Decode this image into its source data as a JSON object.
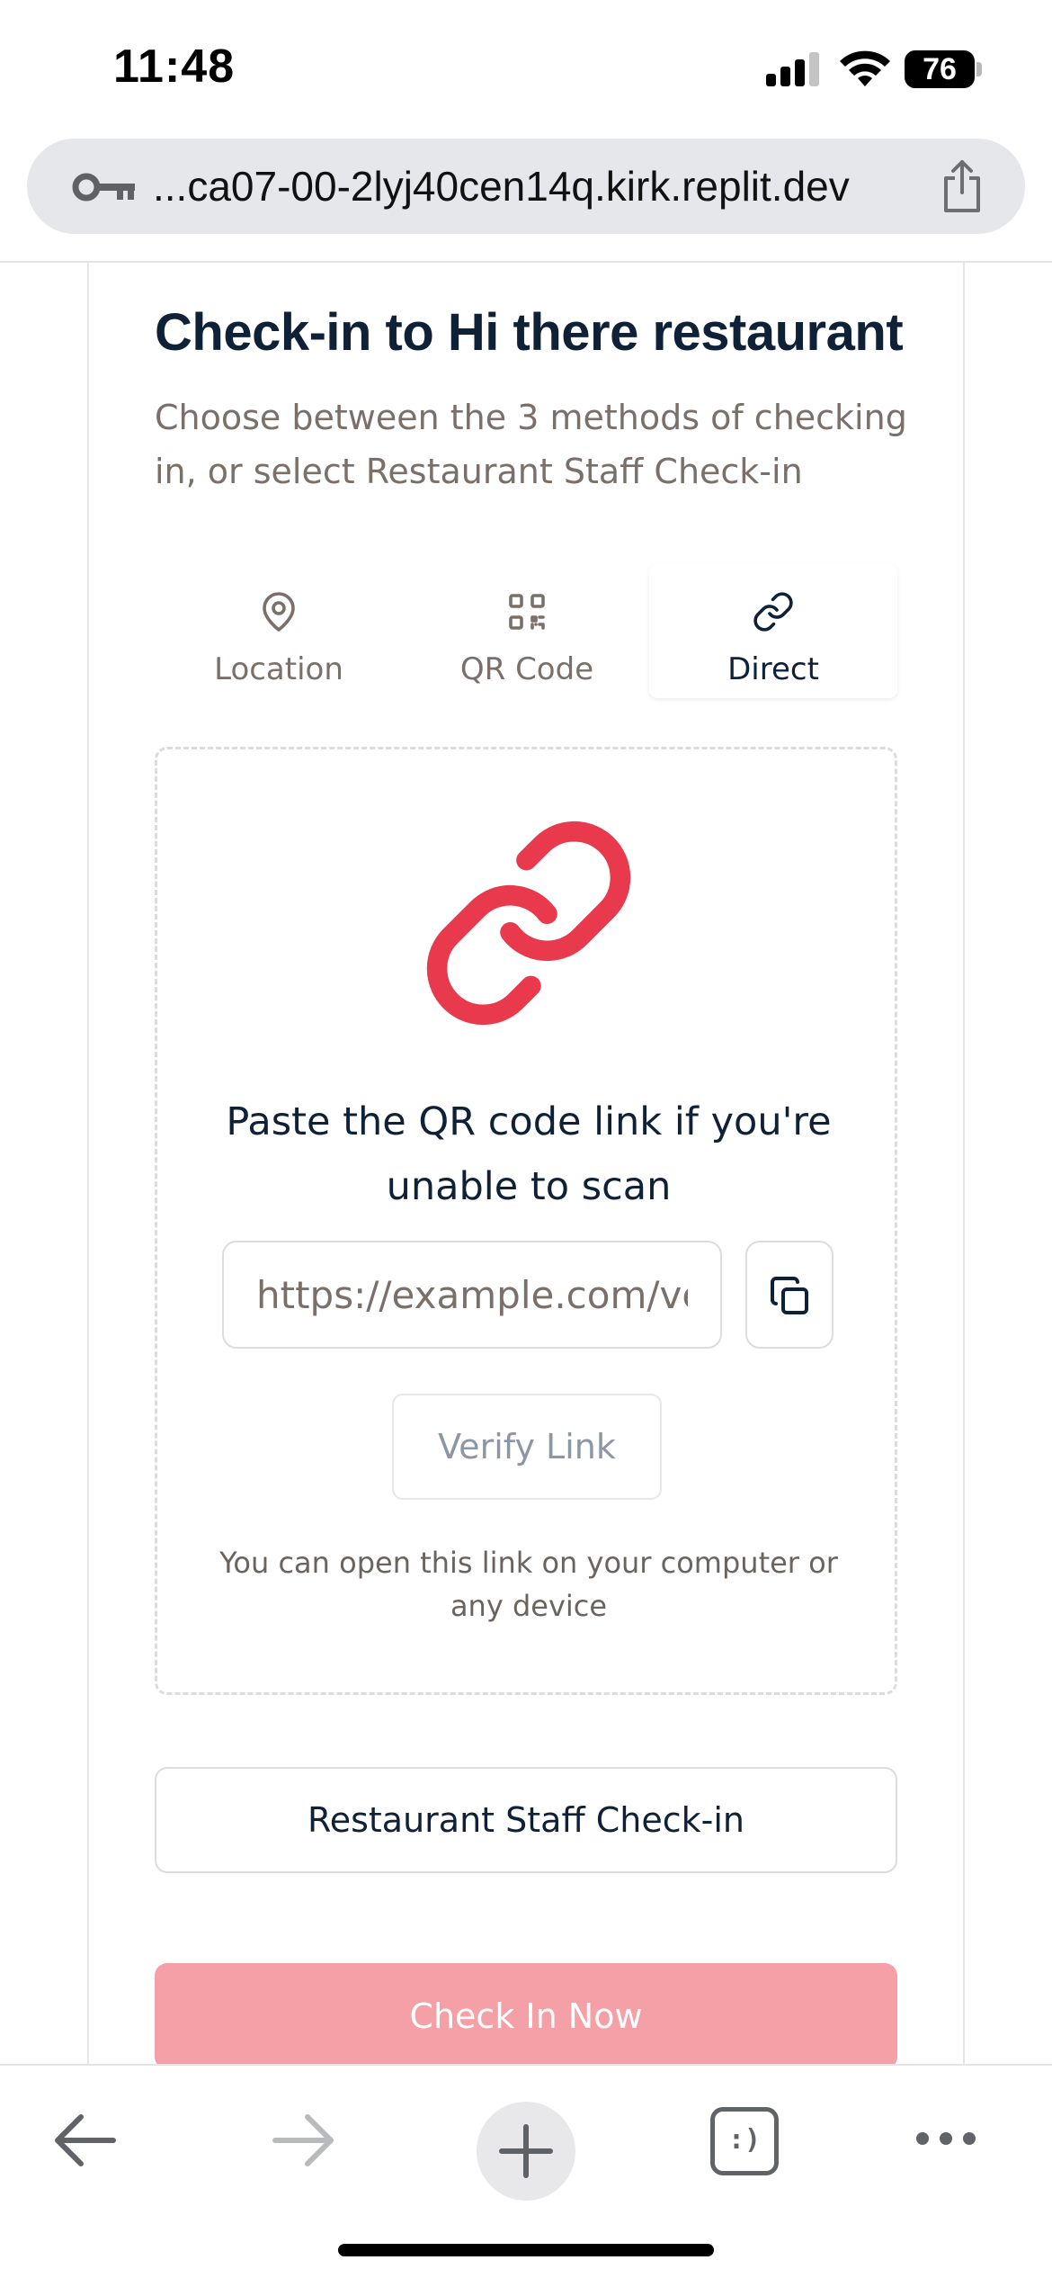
{
  "status_bar": {
    "time": "11:48",
    "battery": "76"
  },
  "url_bar": {
    "url": "...ca07-00-2lyj40cen14q.kirk.replit.dev"
  },
  "page": {
    "title": "Check-in to Hi there restaurant",
    "subtitle": "Choose between the 3 methods of checking in, or select Restaurant Staff Check-in"
  },
  "tabs": [
    {
      "label": "Location",
      "icon": "map-pin-icon",
      "active": false
    },
    {
      "label": "QR Code",
      "icon": "qr-code-icon",
      "active": false
    },
    {
      "label": "Direct",
      "icon": "link-icon",
      "active": true
    }
  ],
  "direct": {
    "heading": "Paste the QR code link if you're unable to scan",
    "input_placeholder": "https://example.com/verify",
    "verify_label": "Verify Link",
    "helper": "You can open this link on your computer or any device",
    "accent_color": "#e8394d"
  },
  "actions": {
    "staff_label": "Restaurant Staff Check-in",
    "checkin_label": "Check In Now",
    "checkin_color": "#f4a0a6"
  },
  "toolbar": {
    "tabs_label": ":)"
  }
}
